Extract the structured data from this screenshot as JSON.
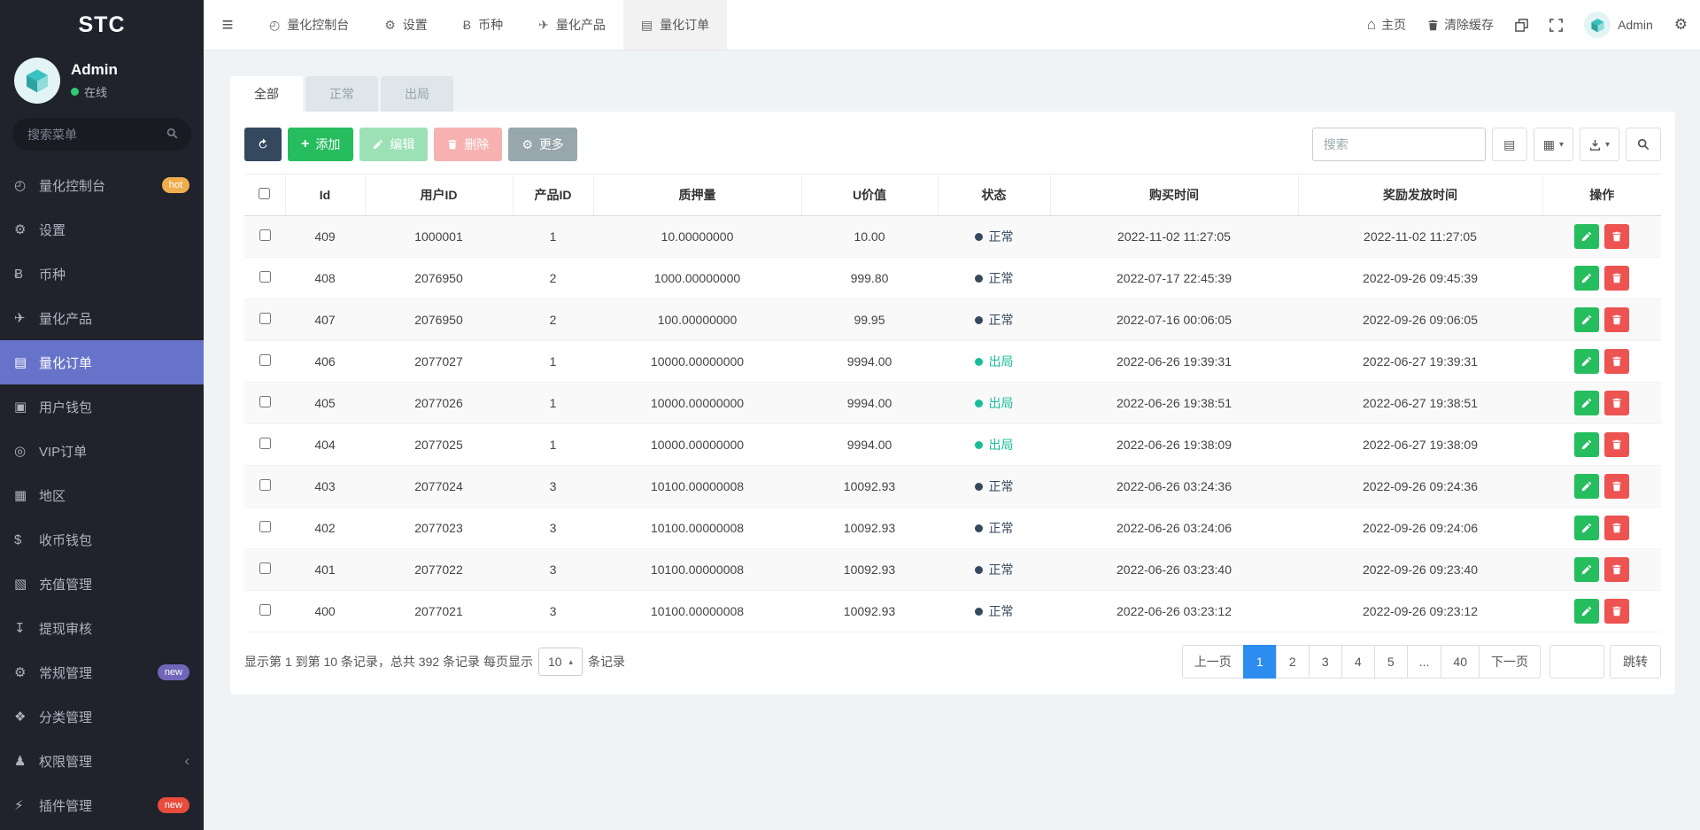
{
  "brand": "STC",
  "colors": {
    "sidebar_bg": "#20222c",
    "accent_purple": "#6673c8",
    "success_green": "#26bd5e",
    "danger_red": "#ed5351",
    "dark_navy": "#34495e",
    "pagination_blue": "#2d8cf0",
    "badge_orange": "#f0ad4e",
    "badge_purple": "#7266ba",
    "badge_red": "#e74c3c",
    "status_out_teal": "#1abc9c",
    "online_green": "#2ecc71"
  },
  "icons": {
    "hamburger": "≡",
    "caret_down": "▾",
    "caret_up": "▴",
    "card_view": "▤",
    "columns": "▦",
    "gear": "⚙",
    "plus": "+",
    "home": "⌂"
  },
  "sidebar": {
    "user": {
      "name": "Admin",
      "status": "在线"
    },
    "search_placeholder": "搜索菜单",
    "menu": [
      {
        "key": "quant-console",
        "label": "量化控制台",
        "icon": "dashboard-icon",
        "glyph": "◴",
        "badge": "hot",
        "badge_style": "hot"
      },
      {
        "key": "settings",
        "label": "设置",
        "icon": "gear-icon",
        "glyph": "⚙"
      },
      {
        "key": "coins",
        "label": "币种",
        "icon": "bitcoin-icon",
        "glyph": "Ƀ"
      },
      {
        "key": "quant-products",
        "label": "量化产品",
        "icon": "send-icon",
        "glyph": "✈"
      },
      {
        "key": "quant-orders",
        "label": "量化订单",
        "icon": "orders-icon",
        "glyph": "▤",
        "active": true
      },
      {
        "key": "user-wallet",
        "label": "用户钱包",
        "icon": "wallet-icon",
        "glyph": "▣"
      },
      {
        "key": "vip-orders",
        "label": "VIP订单",
        "icon": "vip-icon",
        "glyph": "◎"
      },
      {
        "key": "region",
        "label": "地区",
        "icon": "map-icon",
        "glyph": "▦"
      },
      {
        "key": "coin-wallet",
        "label": "收币钱包",
        "icon": "dollar-icon",
        "glyph": "$"
      },
      {
        "key": "recharge",
        "label": "充值管理",
        "icon": "recharge-icon",
        "glyph": "▧"
      },
      {
        "key": "withdraw-audit",
        "label": "提现审核",
        "icon": "withdraw-icon",
        "glyph": "↧"
      },
      {
        "key": "general-mgmt",
        "label": "常规管理",
        "icon": "gears-icon",
        "glyph": "⚙",
        "badge": "new",
        "badge_style": "purple"
      },
      {
        "key": "category-mgmt",
        "label": "分类管理",
        "icon": "category-icon",
        "glyph": "❖"
      },
      {
        "key": "permission-mgmt",
        "label": "权限管理",
        "icon": "users-icon",
        "glyph": "♟",
        "chevron": "‹"
      },
      {
        "key": "plugin-mgmt",
        "label": "插件管理",
        "icon": "plugin-icon",
        "glyph": "⚡",
        "badge": "new",
        "badge_style": "red"
      }
    ]
  },
  "topbar": {
    "tabs": [
      {
        "key": "quant-console",
        "label": "量化控制台",
        "icon": "dashboard-icon",
        "glyph": "◴"
      },
      {
        "key": "settings",
        "label": "设置",
        "icon": "gear-icon",
        "glyph": "⚙"
      },
      {
        "key": "coins",
        "label": "币种",
        "icon": "bitcoin-icon",
        "glyph": "Ƀ"
      },
      {
        "key": "quant-products",
        "label": "量化产品",
        "icon": "send-icon",
        "glyph": "✈"
      },
      {
        "key": "quant-orders",
        "label": "量化订单",
        "icon": "orders-icon",
        "glyph": "▤",
        "active": true
      }
    ],
    "home_label": "主页",
    "clear_cache_label": "清除缓存",
    "username": "Admin"
  },
  "filter_tabs": [
    {
      "key": "all",
      "label": "全部",
      "active": true
    },
    {
      "key": "normal",
      "label": "正常"
    },
    {
      "key": "out",
      "label": "出局"
    }
  ],
  "toolbar": {
    "add_label": "添加",
    "edit_label": "编辑",
    "delete_label": "删除",
    "more_label": "更多",
    "search_placeholder": "搜索"
  },
  "table": {
    "columns": [
      "Id",
      "用户ID",
      "产品ID",
      "质押量",
      "U价值",
      "状态",
      "购买时间",
      "奖励发放时间",
      "操作"
    ],
    "rows": [
      {
        "id": "409",
        "user_id": "1000001",
        "product_id": "1",
        "pledge": "10.00000000",
        "u_value": "10.00",
        "status": "正常",
        "status_type": "normal",
        "buy_time": "2022-11-02 11:27:05",
        "reward_time": "2022-11-02 11:27:05"
      },
      {
        "id": "408",
        "user_id": "2076950",
        "product_id": "2",
        "pledge": "1000.00000000",
        "u_value": "999.80",
        "status": "正常",
        "status_type": "normal",
        "buy_time": "2022-07-17 22:45:39",
        "reward_time": "2022-09-26 09:45:39"
      },
      {
        "id": "407",
        "user_id": "2076950",
        "product_id": "2",
        "pledge": "100.00000000",
        "u_value": "99.95",
        "status": "正常",
        "status_type": "normal",
        "buy_time": "2022-07-16 00:06:05",
        "reward_time": "2022-09-26 09:06:05"
      },
      {
        "id": "406",
        "user_id": "2077027",
        "product_id": "1",
        "pledge": "10000.00000000",
        "u_value": "9994.00",
        "status": "出局",
        "status_type": "out",
        "buy_time": "2022-06-26 19:39:31",
        "reward_time": "2022-06-27 19:39:31"
      },
      {
        "id": "405",
        "user_id": "2077026",
        "product_id": "1",
        "pledge": "10000.00000000",
        "u_value": "9994.00",
        "status": "出局",
        "status_type": "out",
        "buy_time": "2022-06-26 19:38:51",
        "reward_time": "2022-06-27 19:38:51"
      },
      {
        "id": "404",
        "user_id": "2077025",
        "product_id": "1",
        "pledge": "10000.00000000",
        "u_value": "9994.00",
        "status": "出局",
        "status_type": "out",
        "buy_time": "2022-06-26 19:38:09",
        "reward_time": "2022-06-27 19:38:09"
      },
      {
        "id": "403",
        "user_id": "2077024",
        "product_id": "3",
        "pledge": "10100.00000008",
        "u_value": "10092.93",
        "status": "正常",
        "status_type": "normal",
        "buy_time": "2022-06-26 03:24:36",
        "reward_time": "2022-09-26 09:24:36"
      },
      {
        "id": "402",
        "user_id": "2077023",
        "product_id": "3",
        "pledge": "10100.00000008",
        "u_value": "10092.93",
        "status": "正常",
        "status_type": "normal",
        "buy_time": "2022-06-26 03:24:06",
        "reward_time": "2022-09-26 09:24:06"
      },
      {
        "id": "401",
        "user_id": "2077022",
        "product_id": "3",
        "pledge": "10100.00000008",
        "u_value": "10092.93",
        "status": "正常",
        "status_type": "normal",
        "buy_time": "2022-06-26 03:23:40",
        "reward_time": "2022-09-26 09:23:40"
      },
      {
        "id": "400",
        "user_id": "2077021",
        "product_id": "3",
        "pledge": "10100.00000008",
        "u_value": "10092.93",
        "status": "正常",
        "status_type": "normal",
        "buy_time": "2022-06-26 03:23:12",
        "reward_time": "2022-09-26 09:23:12"
      }
    ]
  },
  "footer": {
    "summary_prefix": "显示第 1 到第 10 条记录，总共 392 条记录 每页显示",
    "page_size": "10",
    "summary_suffix": "条记录"
  },
  "pagination": {
    "prev": "上一页",
    "next": "下一页",
    "pages": [
      "1",
      "2",
      "3",
      "4",
      "5",
      "...",
      "40"
    ],
    "active": "1",
    "jump_value": "",
    "jump_label": "跳转"
  }
}
